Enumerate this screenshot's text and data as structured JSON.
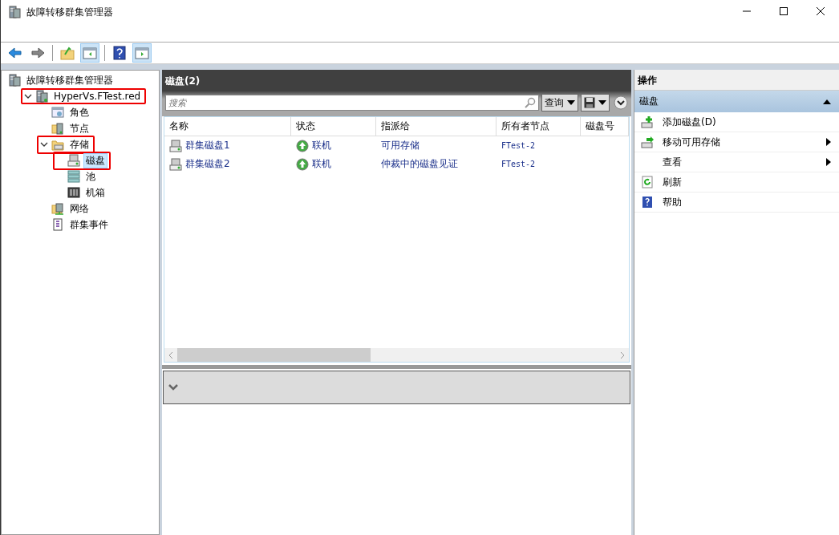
{
  "window": {
    "title": "故障转移群集管理器"
  },
  "toolbar": [
    [
      {
        "kind": "back",
        "pressed": false
      },
      {
        "kind": "forward",
        "pressed": false
      }
    ],
    [
      {
        "kind": "up",
        "pressed": false
      },
      {
        "kind": "console-tree",
        "pressed": true
      }
    ],
    [
      {
        "kind": "help",
        "pressed": false
      },
      {
        "kind": "action-pane",
        "pressed": true
      }
    ]
  ],
  "tree": [
    {
      "label": "故障转移群集管理器",
      "kind": "manager",
      "selected": false,
      "annotated": false,
      "children": [
        {
          "label": "HyperVs.FTest.red",
          "kind": "cluster",
          "expanded": true,
          "selected": false,
          "annotated": true,
          "children": [
            {
              "label": "角色",
              "kind": "roles",
              "selected": false,
              "annotated": false
            },
            {
              "label": "节点",
              "kind": "nodes",
              "selected": false,
              "annotated": false
            },
            {
              "label": "存储",
              "kind": "storage",
              "expanded": true,
              "selected": false,
              "annotated": true,
              "children": [
                {
                  "label": "磁盘",
                  "kind": "disk",
                  "selected": true,
                  "annotated": true
                },
                {
                  "label": "池",
                  "kind": "pool",
                  "selected": false,
                  "annotated": false
                },
                {
                  "label": "机箱",
                  "kind": "enclosure",
                  "selected": false,
                  "annotated": false
                }
              ]
            },
            {
              "label": "网络",
              "kind": "network",
              "selected": false,
              "annotated": false
            },
            {
              "label": "群集事件",
              "kind": "events",
              "selected": false,
              "annotated": false
            }
          ]
        }
      ]
    }
  ],
  "center": {
    "title": "磁盘(2)",
    "search": {
      "placeholder": "搜索"
    },
    "query_button": "查询",
    "columns": [
      "名称",
      "状态",
      "指派给",
      "所有者节点",
      "磁盘号"
    ],
    "rows": [
      {
        "name": "群集磁盘1",
        "status": "联机",
        "assigned_to": "可用存储",
        "owner_node": "FTest-2"
      },
      {
        "name": "群集磁盘2",
        "status": "联机",
        "assigned_to": "仲裁中的磁盘见证",
        "owner_node": "FTest-2"
      }
    ]
  },
  "actions": {
    "title": "操作",
    "section": {
      "label": "磁盘",
      "expanded": true
    },
    "items": [
      {
        "label": "添加磁盘(D)",
        "kind": "add-disk",
        "submenu": false
      },
      {
        "label": "移动可用存储",
        "kind": "move-storage",
        "submenu": true
      },
      {
        "label": "查看",
        "kind": "none",
        "submenu": true
      },
      {
        "label": "刷新",
        "kind": "refresh",
        "submenu": false
      },
      {
        "label": "帮助",
        "kind": "help",
        "submenu": false
      }
    ]
  }
}
